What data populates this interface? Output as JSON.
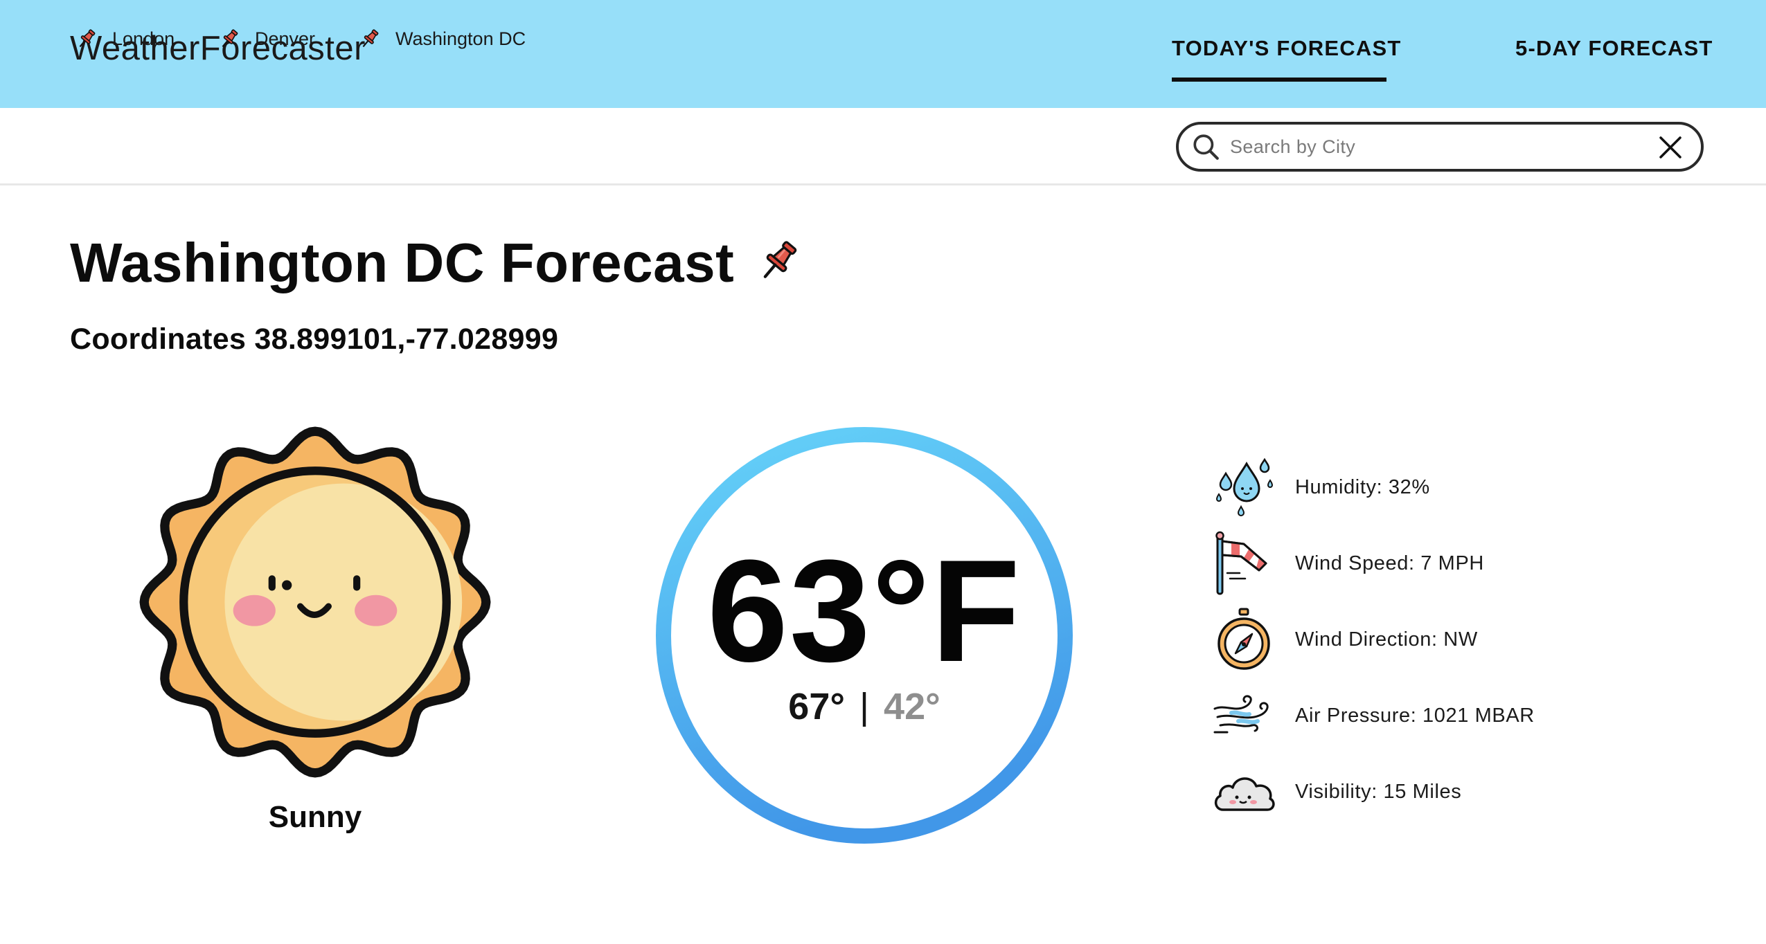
{
  "app": {
    "title": "WeatherForecaster",
    "colors": {
      "appbar": "#97dff9",
      "ring_start": "#66d3f9",
      "ring_end": "#4197e8",
      "sun_outer": "#f5b563",
      "sun_inner": "#f8e2a6"
    }
  },
  "nav": {
    "tabs": [
      {
        "label": "TODAY'S FORECAST",
        "active": true
      },
      {
        "label": "5-DAY FORECAST",
        "active": false
      }
    ]
  },
  "pinned": {
    "icon": "pushpin-icon",
    "cities": [
      {
        "label": "London"
      },
      {
        "label": "Denver"
      },
      {
        "label": "Washington DC"
      }
    ]
  },
  "search": {
    "placeholder": "Search by City",
    "value": "",
    "icon": "search-icon",
    "clear_icon": "close-icon"
  },
  "forecast": {
    "title": "Washington DC Forecast",
    "coordinates": "Coordinates 38.899101,-77.028999",
    "condition": "Sunny",
    "condition_icon": "sun-face-icon",
    "temperature": "63°F",
    "high": "67°",
    "separator": "|",
    "low": "42°"
  },
  "details": [
    {
      "icon": "humidity-drops-icon",
      "label": "Humidity: 32%"
    },
    {
      "icon": "windsock-icon",
      "label": "Wind Speed: 7 MPH"
    },
    {
      "icon": "compass-icon",
      "label": "Wind Direction: NW"
    },
    {
      "icon": "wind-gust-icon",
      "label": "Air Pressure: 1021 MBAR"
    },
    {
      "icon": "cloud-face-icon",
      "label": "Visibility: 15 Miles"
    }
  ]
}
